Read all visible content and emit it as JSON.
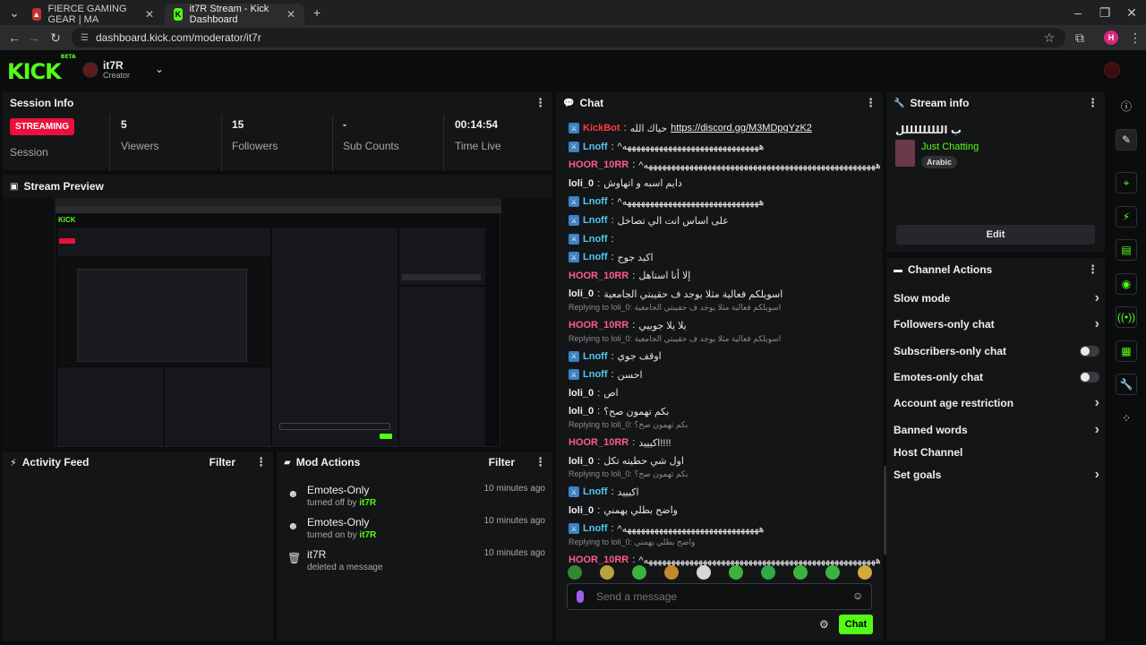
{
  "browser": {
    "tabs": [
      {
        "title": "FIERCE GAMING GEAR | MA",
        "active": false
      },
      {
        "title": "it7R Stream - Kick Dashboard",
        "active": true
      }
    ],
    "url": "dashboard.kick.com/moderator/it7r",
    "profile_initial": "H"
  },
  "header": {
    "logo": "KICK",
    "logo_sup": "BETA",
    "channel_name": "it7R",
    "channel_role": "Creator"
  },
  "session_info": {
    "title": "Session Info",
    "status_badge": "STREAMING",
    "session_label": "Session",
    "stats": [
      {
        "value": "5",
        "label": "Viewers"
      },
      {
        "value": "15",
        "label": "Followers"
      },
      {
        "value": "-",
        "label": "Sub Counts"
      },
      {
        "value": "00:14:54",
        "label": "Time Live"
      }
    ]
  },
  "stream_preview": {
    "title": "Stream Preview"
  },
  "activity_feed": {
    "title": "Activity Feed",
    "filter": "Filter"
  },
  "mod_actions": {
    "title": "Mod Actions",
    "filter": "Filter",
    "items": [
      {
        "title": "Emotes-Only",
        "sub_prefix": "turned off by",
        "user": "it7R",
        "time": "10 minutes ago",
        "icon": "smiley-icon"
      },
      {
        "title": "Emotes-Only",
        "sub_prefix": "turned on by",
        "user": "it7R",
        "time": "10 minutes ago",
        "icon": "smiley-icon"
      },
      {
        "title": "it7R",
        "sub_prefix": "deleted a message",
        "user": "",
        "time": "10 minutes ago",
        "icon": "trash-icon"
      }
    ]
  },
  "chat": {
    "title": "Chat",
    "messages": [
      {
        "user": "KickBot",
        "text": "حياك الله",
        "link": "https://discord.gg/M3MDpgYzK2",
        "mod": true
      },
      {
        "user": "Lnoff",
        "text": "^ههههههههههههههههههههههههههههههه",
        "mod": true
      },
      {
        "user": "HOOR_10RR",
        "text": "^هههههههههههههههههههههههههههههههههههههههههههههههههههه",
        "mod": false
      },
      {
        "user": "loli_0",
        "text": "دايم اسبه و اتهاوش",
        "mod": false
      },
      {
        "user": "Lnoff",
        "text": "^ههههههههههههههههههههههههههههههه",
        "mod": true
      },
      {
        "user": "Lnoff",
        "text": "على اساس انت الي تصاخل",
        "mod": true
      },
      {
        "user": "Lnoff",
        "text": "",
        "mod": true
      },
      {
        "user": "Lnoff",
        "text": "اكيد جوج",
        "mod": true
      },
      {
        "user": "HOOR_10RR",
        "text": "إلا أنا استاهل",
        "mod": false
      },
      {
        "user": "loli_0",
        "text": "اسويلكم فعالية مثلا يوجد ف حقيبتي الجامعية",
        "mod": false
      },
      {
        "user": "HOOR_10RR",
        "text": "يلا يلا جوييي",
        "mod": false,
        "reply": "Replying to loli_0: اسويلكم فعالية مثلا يوجد ف حقيبتي الجامعية"
      },
      {
        "user": "Lnoff",
        "text": "اوقف جوي",
        "mod": true,
        "reply": "Replying to loli_0: اسويلكم فعالية مثلا يوجد ف حقيبتي الجامعية"
      },
      {
        "user": "Lnoff",
        "text": "احسن",
        "mod": true
      },
      {
        "user": "loli_0",
        "text": "اص",
        "mod": false
      },
      {
        "user": "loli_0",
        "text": "بكم تهمون صح؟",
        "mod": false
      },
      {
        "user": "HOOR_10RR",
        "text": "اكيييد!!!!",
        "mod": false,
        "reply": "Replying to loli_0: بكم تهمون صح؟"
      },
      {
        "user": "loli_0",
        "text": "اول شي حطيته تكل",
        "mod": false
      },
      {
        "user": "Lnoff",
        "text": "اكيييد",
        "mod": true,
        "reply": "Replying to loli_0: بكم تهمون صح؟"
      },
      {
        "user": "loli_0",
        "text": "واضح بطلي يهمني",
        "mod": false
      },
      {
        "user": "Lnoff",
        "text": "^ههههههههههههههههههههههههههههههه",
        "mod": true
      },
      {
        "user": "HOOR_10RR",
        "text": "^هههههههههههههههههههههههههههههههههههههههههههههههههههه",
        "mod": false,
        "reply": "Replying to loli_0: واضح بطلي يهمني"
      }
    ],
    "input_placeholder": "Send a message",
    "send_label": "Chat"
  },
  "stream_info": {
    "title": "Stream info",
    "stream_title": "ب الللللللللل",
    "category": "Just Chatting",
    "tag": "Arabic",
    "edit_label": "Edit"
  },
  "channel_actions": {
    "title": "Channel Actions",
    "rows": [
      {
        "label": "Slow mode",
        "control": "chevron"
      },
      {
        "label": "Followers-only chat",
        "control": "chevron"
      },
      {
        "label": "Subscribers-only chat",
        "control": "toggle"
      },
      {
        "label": "Emotes-only chat",
        "control": "toggle"
      },
      {
        "label": "Account age restriction",
        "control": "chevron"
      },
      {
        "label": "Banned words",
        "control": "chevron"
      },
      {
        "label": "Host Channel",
        "control": "none"
      },
      {
        "label": "Set goals",
        "control": "chevron"
      }
    ]
  },
  "colors": {
    "brand": "#53fc18",
    "streaming": "#e9113c",
    "panel": "#141517",
    "bg": "#0b0c0e"
  }
}
